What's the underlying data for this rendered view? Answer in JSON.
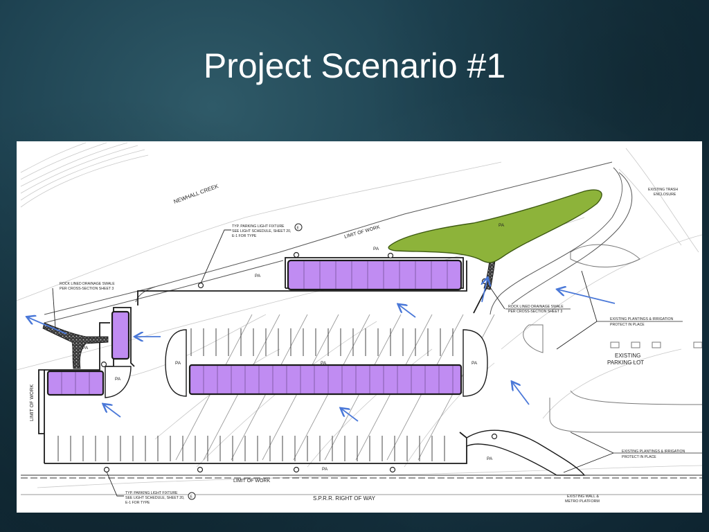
{
  "slide": {
    "title": "Project Scenario #1"
  },
  "plan": {
    "labels": {
      "creek": "NEWHALL CREEK",
      "limit_of_work_top": "LIMIT OF WORK",
      "limit_of_work_bottom": "LIMIT OF WORK",
      "limit_of_work_left": "LIMIT OF WORK",
      "row": "S.P.R.R. RIGHT OF WAY",
      "existing_parking_1": "EXISTING",
      "existing_parking_2": "PARKING LOT",
      "pa": "PA"
    },
    "callouts": {
      "light_top_1": "TYP. PARKING LIGHT FIXTURE",
      "light_top_2": "SEE LIGHT SCHEDULE, SHEET 20,",
      "light_top_3": "E-1 FOR TYPE",
      "light_bottom_1": "TYP. PARKING LIGHT FIXTURE",
      "light_bottom_2": "SEE LIGHT SCHEDULE, SHEET 20,",
      "light_bottom_3": "E-1 FOR TYPE",
      "symbol": "E",
      "swale_left_1": "ROCK LINED DRAINAGE SWALE",
      "swale_left_2": "PER CROSS-SECTION SHEET 3",
      "swale_right_1": "ROCK LINED DRAINAGE SWALE",
      "swale_right_2": "PER CROSS-SECTION SHEET 3",
      "trash_1": "EXISTING TRASH",
      "trash_2": "ENCLOSURE",
      "plantings_top_1": "EXISTING PLANTINGS & IRRIGATION",
      "plantings_top_2": "PROTECT IN PLACE",
      "plantings_bottom_1": "EXISTING PLANTINGS & IRRIGATION",
      "plantings_bottom_2": "PROTECT IN PLACE",
      "wall_1": "EXISTING WALL &",
      "wall_2": "METRO PLATFORM"
    },
    "colors": {
      "bioretention": "#c08cf2",
      "green_area": "#8db33a",
      "flow_arrow": "#4a78d8",
      "outline": "#1a1a1a"
    }
  }
}
